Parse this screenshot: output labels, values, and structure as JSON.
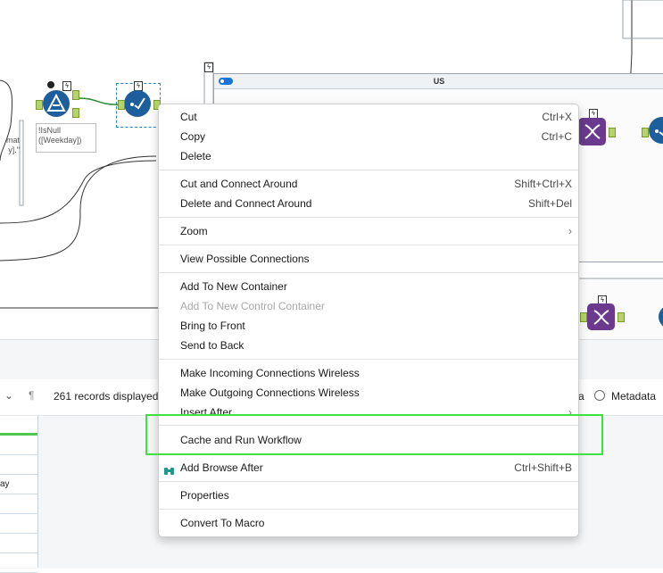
{
  "canvas": {
    "container_title": "US",
    "filter_expression": "!IsNull\n([Weekday])",
    "annotation_partial_1": "mat",
    "annotation_partial_2": "y].\""
  },
  "results": {
    "records_label": "261 records displayed",
    "data_partial": "a",
    "metadata_label": "Metadata",
    "row_partial": "ay"
  },
  "context_menu": {
    "groups": [
      [
        {
          "label": "Cut",
          "shortcut": "Ctrl+X"
        },
        {
          "label": "Copy",
          "shortcut": "Ctrl+C"
        },
        {
          "label": "Delete",
          "shortcut": ""
        }
      ],
      [
        {
          "label": "Cut and Connect Around",
          "shortcut": "Shift+Ctrl+X"
        },
        {
          "label": "Delete and Connect Around",
          "shortcut": "Shift+Del"
        }
      ],
      [
        {
          "label": "Zoom",
          "submenu": true
        }
      ],
      [
        {
          "label": "View Possible Connections"
        }
      ],
      [
        {
          "label": "Add To New Container"
        },
        {
          "label": "Add To New Control Container",
          "disabled": true
        },
        {
          "label": "Bring to Front"
        },
        {
          "label": "Send to Back"
        }
      ],
      [
        {
          "label": "Make Incoming Connections Wireless"
        },
        {
          "label": "Make Outgoing Connections Wireless"
        },
        {
          "label": "Insert After",
          "submenu": true
        }
      ],
      [
        {
          "label": "Cache and Run Workflow"
        }
      ],
      [
        {
          "label": "Add Browse After",
          "shortcut": "Ctrl+Shift+B",
          "icon": "binoculars-icon"
        }
      ],
      [
        {
          "label": "Properties"
        }
      ],
      [
        {
          "label": "Convert To Macro"
        }
      ]
    ]
  },
  "colors": {
    "highlight": "#3fe33f",
    "tool_blue": "#1d5f9c",
    "tool_purple": "#6b3a8e",
    "anchor_green": "#b5d36a"
  }
}
